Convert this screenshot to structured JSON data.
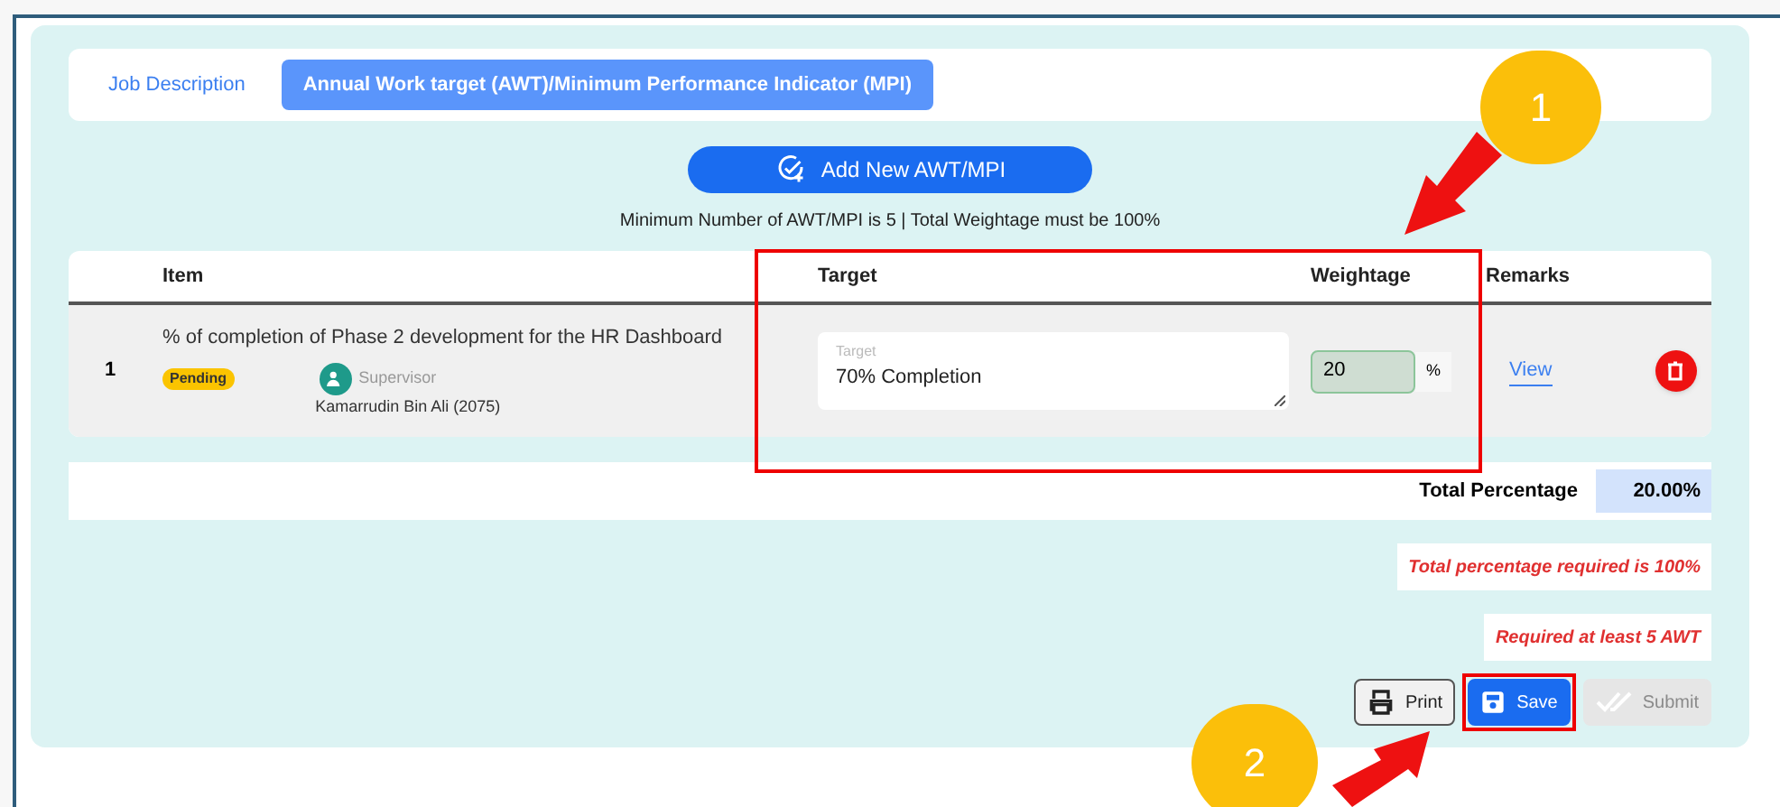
{
  "tabs": [
    {
      "label": "Job Description",
      "selected": false
    },
    {
      "label": "Annual Work target (AWT)/Minimum Performance Indicator (MPI)",
      "selected": true
    }
  ],
  "add_button": "Add New AWT/MPI",
  "note": "Minimum Number of AWT/MPI is 5 | Total Weightage must be 100%",
  "table": {
    "columns": [
      "Item",
      "Target",
      "Weightage",
      "Remarks"
    ],
    "rows": [
      {
        "number": "1",
        "item": "% of completion of Phase 2 development for the HR Dashboard",
        "status": "Pending",
        "role": "Supervisor",
        "person": "Kamarrudin Bin Ali (2075)",
        "target_placeholder": "Target",
        "target": "70% Completion",
        "weightage": "20",
        "unit": "%",
        "remarks_link": "View"
      }
    ]
  },
  "total": {
    "label": "Total Percentage",
    "value": "20.00%"
  },
  "errors": [
    "Total percentage required is 100%",
    "Required at least 5 AWT"
  ],
  "buttons": [
    {
      "label": "Print",
      "kind": "print",
      "disabled": false
    },
    {
      "label": "Save",
      "kind": "save",
      "disabled": false
    },
    {
      "label": "Submit",
      "kind": "submit",
      "disabled": true
    }
  ],
  "annotations": [
    "1",
    "2"
  ]
}
